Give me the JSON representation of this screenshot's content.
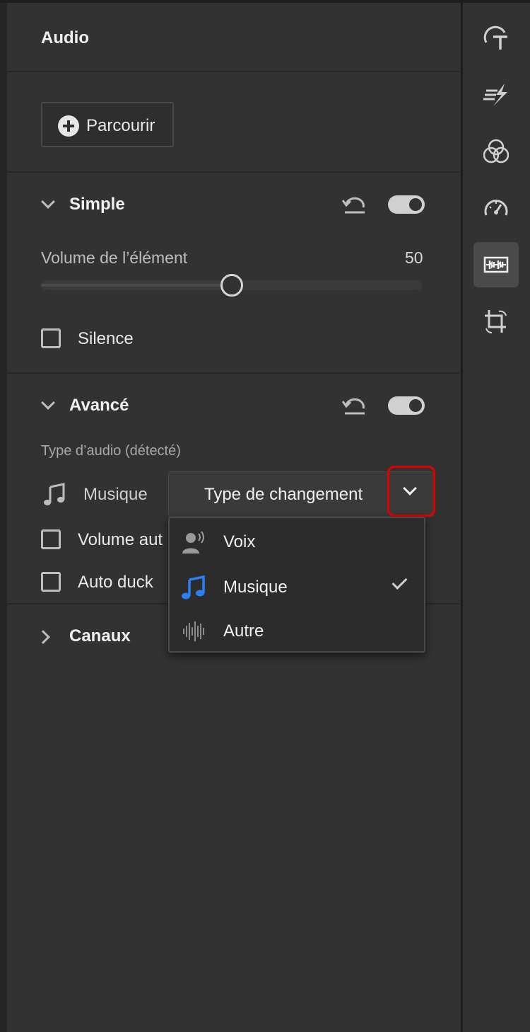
{
  "panel": {
    "title": "Audio"
  },
  "browse": {
    "label": "Parcourir"
  },
  "simple": {
    "title": "Simple",
    "volume_label": "Volume de l’élément",
    "volume_value": "50",
    "volume_fraction": 0.5,
    "silence_label": "Silence",
    "toggle_on": true
  },
  "advanced": {
    "title": "Avancé",
    "audio_type_label": "Type d’audio (détecté)",
    "detected_type": "Musique",
    "picker_label": "Type de changement",
    "auto_volume_label": "Volume aut",
    "auto_duck_label": "Auto duck",
    "toggle_on": true
  },
  "menu": {
    "items": [
      {
        "label": "Voix",
        "icon": "voice-icon",
        "selected": false
      },
      {
        "label": "Musique",
        "icon": "music-note-icon",
        "selected": true
      },
      {
        "label": "Autre",
        "icon": "waveform-icon",
        "selected": false
      }
    ]
  },
  "channels": {
    "title": "Canaux"
  },
  "rail": {
    "items": [
      "text-title-icon",
      "transition-icon",
      "color-circles-icon",
      "speed-gauge-icon",
      "audio-waveform-icon",
      "crop-rotate-icon"
    ],
    "active": "audio-waveform-icon"
  },
  "colors": {
    "accent": "#2d7ff9",
    "highlight": "#e00000",
    "panel_bg": "#323232"
  }
}
